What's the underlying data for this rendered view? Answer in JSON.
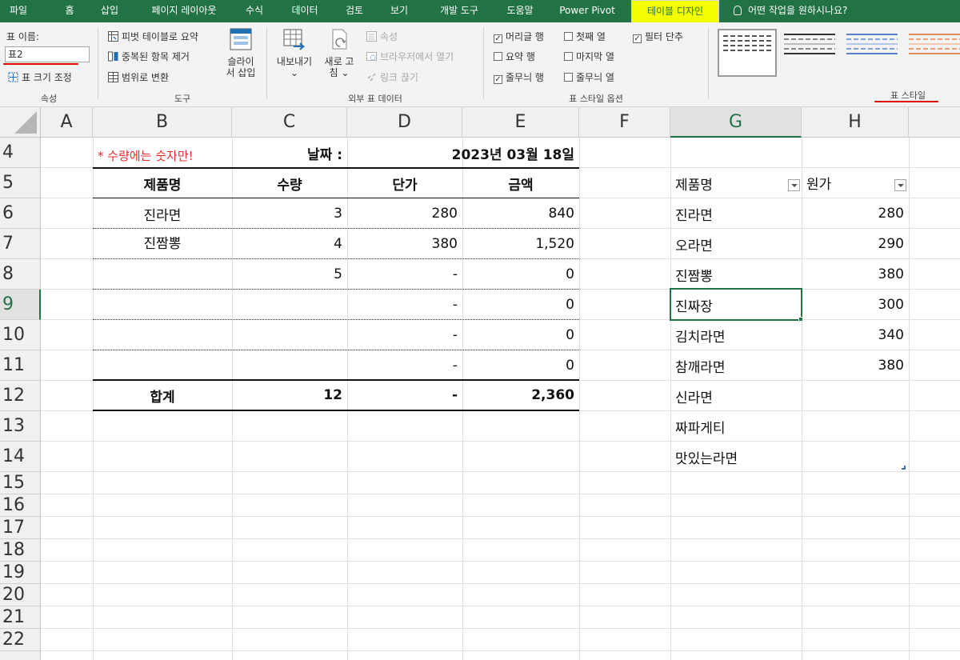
{
  "ribbon_tabs": [
    {
      "label": "파일"
    },
    {
      "label": "홈"
    },
    {
      "label": "삽입"
    },
    {
      "label": "페이지 레이아웃"
    },
    {
      "label": "수식"
    },
    {
      "label": "데이터"
    },
    {
      "label": "검토"
    },
    {
      "label": "보기"
    },
    {
      "label": "개발 도구"
    },
    {
      "label": "도움말"
    },
    {
      "label": "Power Pivot"
    },
    {
      "label": "테이블 디자인"
    }
  ],
  "tell_me": "어떤 작업을 원하시나요?",
  "groups": {
    "properties": {
      "label": "속성",
      "table_name_label": "표 이름:",
      "table_name_value": "표2",
      "resize": "표 크기 조정"
    },
    "tools": {
      "label": "도구",
      "pivot": "피벗 테이블로 요약",
      "remove_dupes": "중복된 항목 제거",
      "convert": "범위로 변환",
      "slicer_line1": "슬라이",
      "slicer_line2": "서 삽입"
    },
    "external": {
      "label": "외부 표 데이터",
      "export_line1": "내보내기",
      "export_line2": "⌄",
      "refresh_line1": "새로 고",
      "refresh_line2": "침 ⌄",
      "properties": "속성",
      "open_browser": "브라우저에서 열기",
      "unlink": "링크 끊기"
    },
    "style_options": {
      "label": "표 스타일 옵션",
      "header_row": "머리글 행",
      "total_row": "요약 행",
      "banded_rows": "줄무늬 행",
      "first_col": "첫째 열",
      "last_col": "마지막 열",
      "banded_cols": "줄무늬 열",
      "filter_btn": "필터 단추"
    },
    "table_styles": {
      "label": "표 스타일"
    }
  },
  "columns": [
    "A",
    "B",
    "C",
    "D",
    "E",
    "F",
    "G",
    "H"
  ],
  "rows": [
    "4",
    "5",
    "6",
    "7",
    "8",
    "9",
    "10",
    "11",
    "12",
    "13",
    "14",
    "15",
    "16",
    "17",
    "18",
    "19",
    "20",
    "21",
    "22"
  ],
  "sheet": {
    "note": "* 수량에는 숫자만!",
    "date_label": "날짜 :",
    "date_value": "2023년 03월 18일",
    "headers": {
      "name": "제품명",
      "qty": "수량",
      "price": "단가",
      "amount": "금액"
    },
    "items": [
      {
        "name": "진라면",
        "qty": "3",
        "price": "280",
        "amount": "840"
      },
      {
        "name": "진짬뽕",
        "qty": "4",
        "price": "380",
        "amount": "1,520"
      },
      {
        "name": "",
        "qty": "5",
        "price": "-",
        "amount": "0"
      },
      {
        "name": "",
        "qty": "",
        "price": "-",
        "amount": "0"
      },
      {
        "name": "",
        "qty": "",
        "price": "-",
        "amount": "0"
      },
      {
        "name": "",
        "qty": "",
        "price": "-",
        "amount": "0"
      }
    ],
    "total": {
      "label": "합계",
      "qty": "12",
      "price": "-",
      "amount": "2,360"
    }
  },
  "cost_table": {
    "header_name": "제품명",
    "header_cost": "원가",
    "rows": [
      {
        "name": "진라면",
        "cost": "280"
      },
      {
        "name": "오라면",
        "cost": "290"
      },
      {
        "name": "진짬뽕",
        "cost": "380"
      },
      {
        "name": "진짜장",
        "cost": "300"
      },
      {
        "name": "김치라면",
        "cost": "340"
      },
      {
        "name": "참깨라면",
        "cost": "380"
      },
      {
        "name": "신라면",
        "cost": ""
      },
      {
        "name": "짜파게티",
        "cost": ""
      },
      {
        "name": "맛있는라면",
        "cost": ""
      }
    ]
  },
  "colors": {
    "excel_green": "#217346",
    "highlight_yellow": "#f3ff00",
    "annotation_red": "#e00000"
  }
}
